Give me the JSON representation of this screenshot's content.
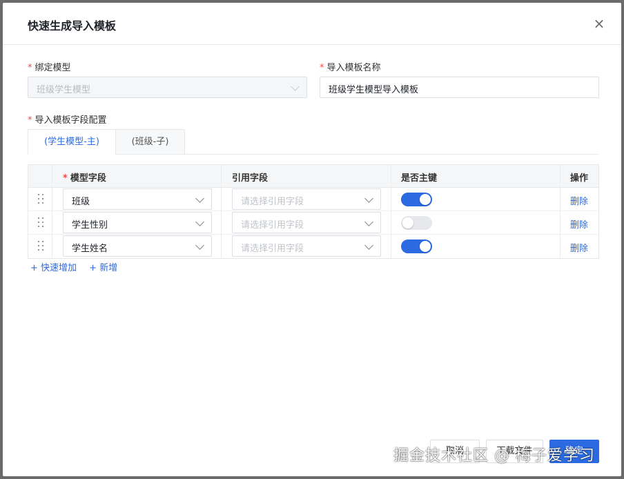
{
  "dialog": {
    "title": "快速生成导入模板",
    "close_icon": "×"
  },
  "form": {
    "required_mark": "*",
    "bind_model": {
      "label": "绑定模型",
      "value": "班级学生模型"
    },
    "template_name": {
      "label": "导入模板名称",
      "value": "班级学生模型导入模板"
    },
    "field_config": {
      "label": "导入模板字段配置"
    }
  },
  "tabs": [
    {
      "label": "(学生模型-主)",
      "active": true
    },
    {
      "label": "(班级-子)",
      "active": false
    }
  ],
  "table": {
    "headers": {
      "model_field": "模型字段",
      "ref_field": "引用字段",
      "is_primary": "是否主键",
      "action": "操作"
    },
    "rows": [
      {
        "model_field": "班级",
        "ref_placeholder": "请选择引用字段",
        "primary": true,
        "action": "删除"
      },
      {
        "model_field": "学生性别",
        "ref_placeholder": "请选择引用字段",
        "primary": false,
        "action": "删除"
      },
      {
        "model_field": "学生姓名",
        "ref_placeholder": "请选择引用字段",
        "primary": true,
        "action": "删除"
      }
    ]
  },
  "add": {
    "quick_add": "+ 快速增加",
    "add_new": "+ 新增"
  },
  "footer": {
    "cancel": "取消",
    "download": "下载文件",
    "confirm": "确定"
  },
  "watermark": "掘金技术社区 @ 梅子爱学习",
  "colors": {
    "accent": "#2b6ae0",
    "required": "#f54a45"
  }
}
